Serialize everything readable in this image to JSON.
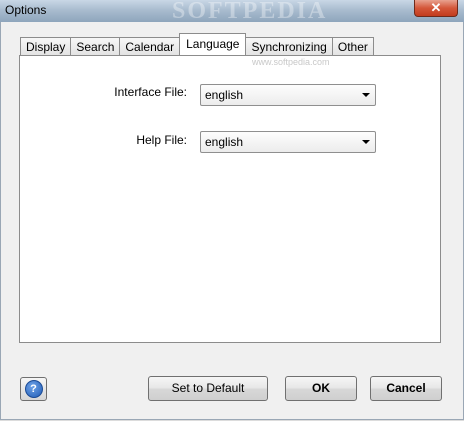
{
  "window": {
    "title": "Options",
    "close_glyph": "✕",
    "watermark": "SOFTPEDIA"
  },
  "tabs": [
    {
      "label": "Display"
    },
    {
      "label": "Search"
    },
    {
      "label": "Calendar"
    },
    {
      "label": "Language"
    },
    {
      "label": "Synchronizing"
    },
    {
      "label": "Other"
    }
  ],
  "active_tab": "Language",
  "panel": {
    "watermark": "www.softpedia.com",
    "interface_file": {
      "label": "Interface File:",
      "value": "english"
    },
    "help_file": {
      "label": "Help File:",
      "value": "english"
    }
  },
  "buttons": {
    "help": "?",
    "set_default": "Set to Default",
    "ok": "OK",
    "cancel": "Cancel"
  },
  "icons": {
    "help": "help-icon",
    "close": "close-icon",
    "dropdown": "chevron-down-icon"
  }
}
